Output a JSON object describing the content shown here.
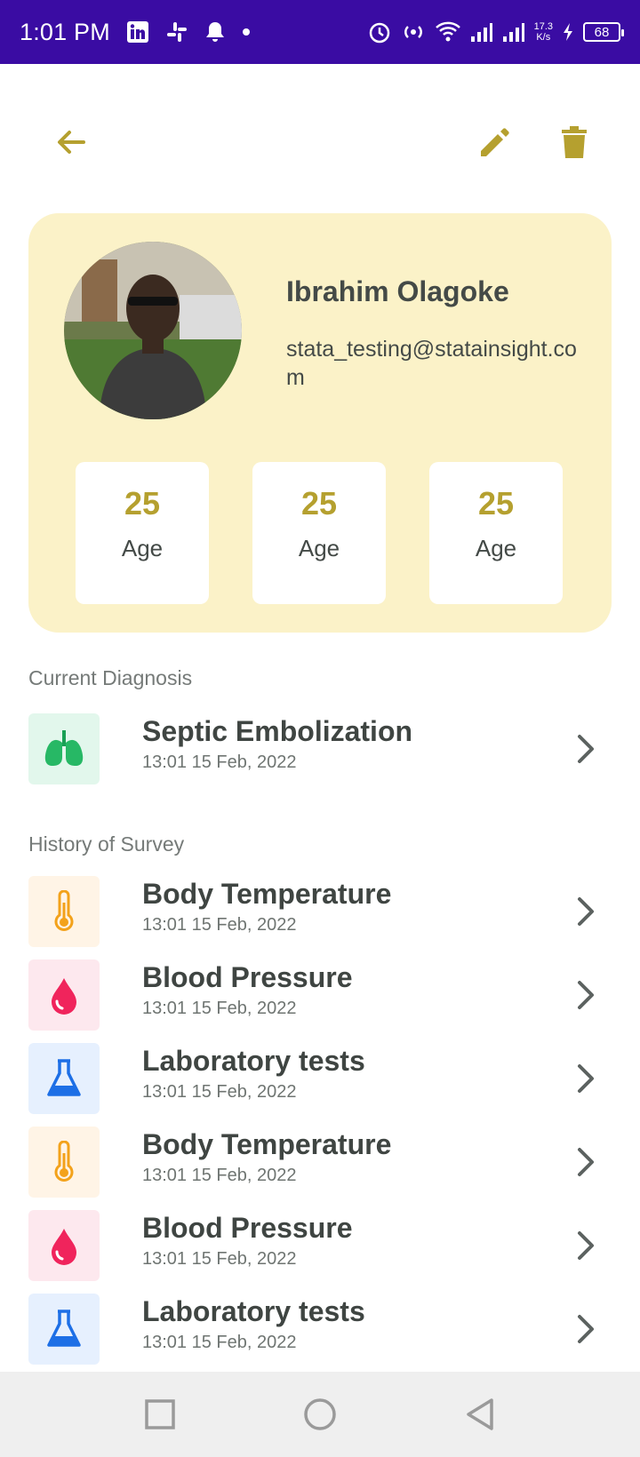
{
  "status_bar": {
    "time": "1:01 PM",
    "network_speed_value": "17.3",
    "network_speed_unit": "K/s",
    "battery": "68"
  },
  "colors": {
    "status_bar": "#3a0ca3",
    "accent": "#b5a02f",
    "card_bg": "#fbf2c8"
  },
  "app_bar": {
    "back_icon": "arrow-back-icon",
    "edit_icon": "pencil-icon",
    "delete_icon": "trash-icon"
  },
  "profile": {
    "name": "Ibrahim Olagoke",
    "email": "stata_testing@statainsight.com",
    "stats": [
      {
        "value": "25",
        "label": "Age"
      },
      {
        "value": "25",
        "label": "Age"
      },
      {
        "value": "25",
        "label": "Age"
      }
    ]
  },
  "current_diagnosis": {
    "title": "Current Diagnosis",
    "item": {
      "icon": "lungs-icon",
      "title": "Septic Embolization",
      "date": "13:01 15 Feb, 2022"
    }
  },
  "history": {
    "title": "History of Survey",
    "items": [
      {
        "icon": "thermometer-icon",
        "title": "Body Temperature",
        "date": "13:01 15 Feb, 2022"
      },
      {
        "icon": "blood-drop-icon",
        "title": "Blood Pressure",
        "date": "13:01 15 Feb, 2022"
      },
      {
        "icon": "flask-icon",
        "title": "Laboratory tests",
        "date": "13:01 15 Feb, 2022"
      },
      {
        "icon": "thermometer-icon",
        "title": "Body Temperature",
        "date": "13:01 15 Feb, 2022"
      },
      {
        "icon": "blood-drop-icon",
        "title": "Blood Pressure",
        "date": "13:01 15 Feb, 2022"
      },
      {
        "icon": "flask-icon",
        "title": "Laboratory tests",
        "date": "13:01 15 Feb, 2022"
      }
    ]
  }
}
